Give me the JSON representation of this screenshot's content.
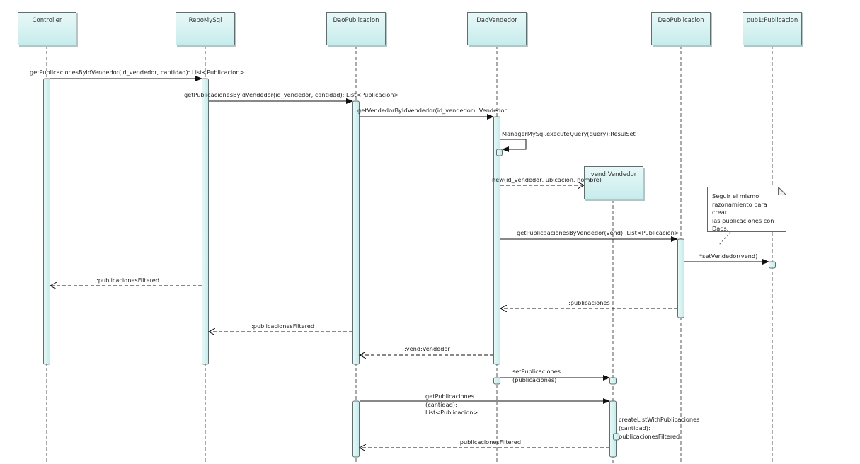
{
  "lifelines": {
    "controller": "Controller",
    "repo": "RepoMySql",
    "daoPub": "DaoPublicacion",
    "daoVend": "DaoVendedor",
    "daoPub2": "DaoPublicacion",
    "pub1": "pub1:Publicacion",
    "vend": "vend:Vendedor"
  },
  "messages": {
    "m1": "getPublicacionesByIdVendedor(id_vendedor, cantidad): List<Publicacion>",
    "m2": "getPublicacionesByIdVendedor(id_vendedor, cantidad): List<Publicacion>",
    "m3": "getVendedorByIdVendedor(id_vendedor): Vendedor",
    "m4": "ManagerMySql.executeQuery(query):ResulSet",
    "m5": "new(id_vendedor, ubicacion, nombre)",
    "m6": "getPublicaacionesByVendedor(vend): List<Publicacion>",
    "m7": "*setVendedor(vend)",
    "m8": ":publicaciones",
    "m9": ":publicacionesFiltered",
    "m10": ":publicacionesFiltered",
    "m11": ":vend:Vendedor",
    "m12a": "setPublicaciones",
    "m12b": "(publicaciones)",
    "m13a": "getPublicaciones",
    "m13b": "(cantidad):",
    "m13c": "List<Publicacion>",
    "m14a": "createListWithPublicaciones",
    "m14b": "(cantidad):",
    "m14c": "publicacionesFiltered",
    "m15": ":publicacionesFiltered"
  },
  "note": {
    "line1": "Seguir el mismo",
    "line2": "razonamiento para crear",
    "line3": "las publicaciones con",
    "line4": "Daos."
  }
}
